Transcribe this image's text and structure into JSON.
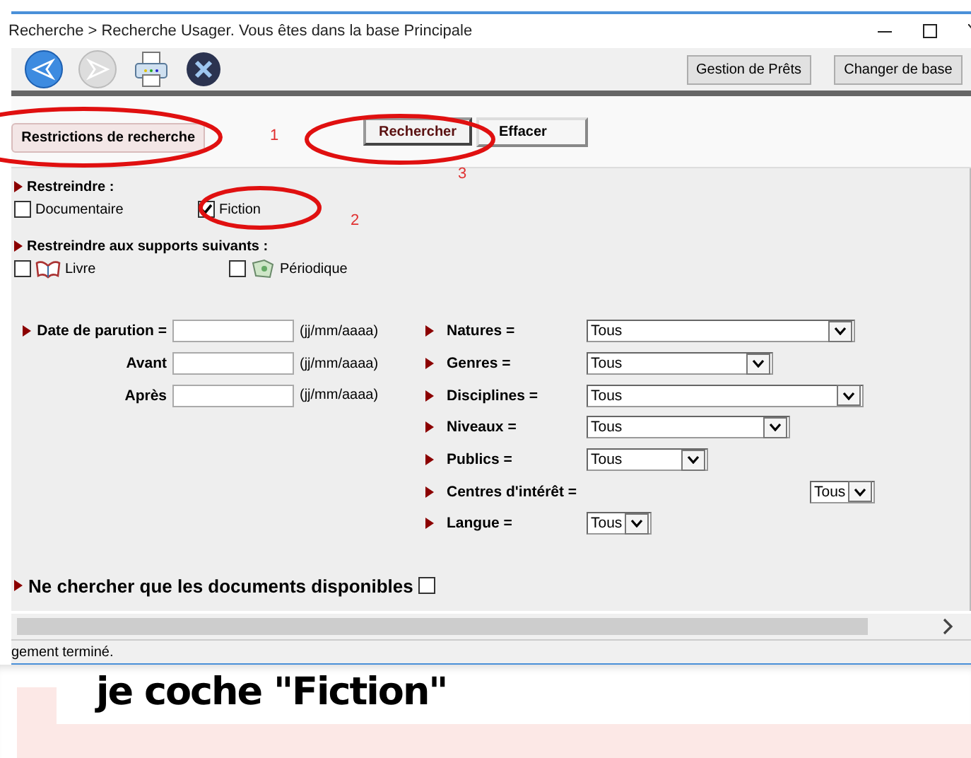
{
  "window": {
    "title": "Recherche > Recherche Usager.  Vous êtes dans la base Principale"
  },
  "toolbar": {
    "buttons": [
      "Gestion de Prêts",
      "Changer de base"
    ]
  },
  "actions": {
    "restrictions": "Restrictions de recherche",
    "search": "Rechercher",
    "clear": "Effacer"
  },
  "restrict": {
    "heading": "Restreindre :",
    "options": [
      {
        "label": "Documentaire",
        "checked": false
      },
      {
        "label": "Fiction",
        "checked": true
      }
    ]
  },
  "supports": {
    "heading": "Restreindre aux supports suivants :",
    "options": [
      {
        "label": "Livre",
        "checked": false,
        "kind": "book"
      },
      {
        "label": "Périodique",
        "checked": false,
        "kind": "periodical"
      }
    ]
  },
  "dates": [
    {
      "label": "Date de parution =",
      "hint": "(jj/mm/aaaa)"
    },
    {
      "label": "Avant",
      "hint": "(jj/mm/aaaa)"
    },
    {
      "label": "Après",
      "hint": "(jj/mm/aaaa)"
    }
  ],
  "filters": [
    {
      "label": "Natures =",
      "value": "Tous"
    },
    {
      "label": "Genres =",
      "value": "Tous"
    },
    {
      "label": "Disciplines =",
      "value": "Tous"
    },
    {
      "label": "Niveaux =",
      "value": "Tous"
    },
    {
      "label": "Publics =",
      "value": "Tous"
    },
    {
      "label": "Centres d'intérêt =",
      "value": "Tous"
    },
    {
      "label": "Langue =",
      "value": "Tous"
    }
  ],
  "available": {
    "label": "Ne chercher que les documents disponibles",
    "checked": false
  },
  "status_bar": "gement terminé.",
  "caption": "je coche \"Fiction\"",
  "annotations": [
    "1",
    "2",
    "3"
  ]
}
